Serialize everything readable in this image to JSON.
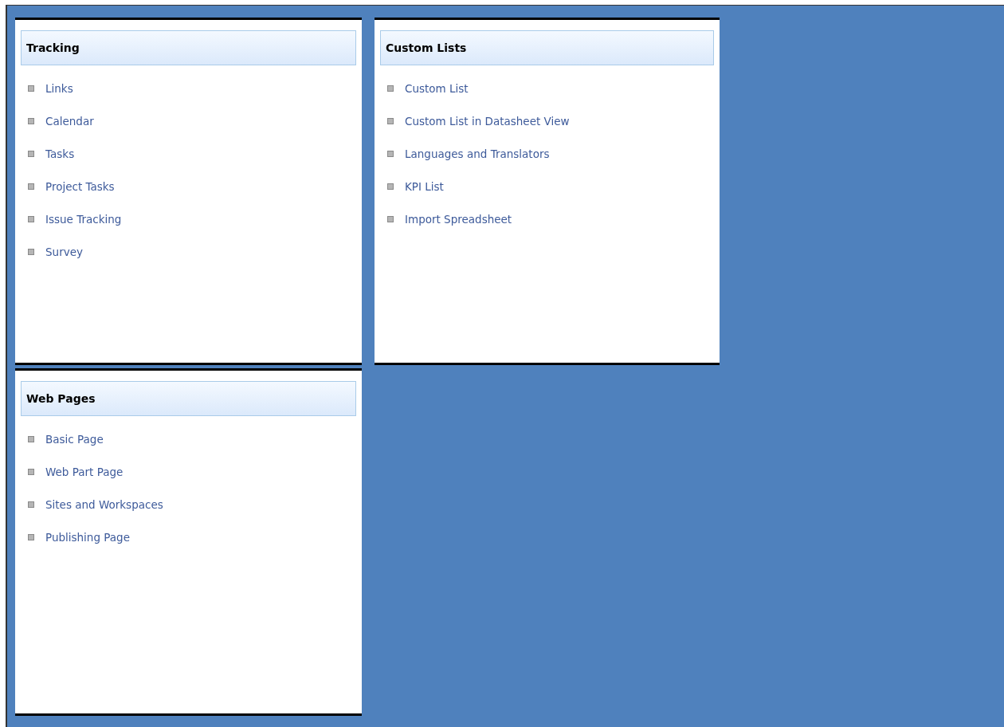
{
  "panels": [
    {
      "title": "Tracking",
      "items": [
        "Links",
        "Calendar",
        "Tasks",
        "Project Tasks",
        "Issue Tracking",
        "Survey"
      ]
    },
    {
      "title": "Custom Lists",
      "items": [
        "Custom List",
        "Custom List in Datasheet View",
        "Languages and Translators",
        "KPI List",
        "Import Spreadsheet"
      ]
    },
    {
      "title": "Web Pages",
      "items": [
        "Basic Page",
        "Web Part Page",
        "Sites and Workspaces",
        "Publishing Page"
      ]
    }
  ]
}
